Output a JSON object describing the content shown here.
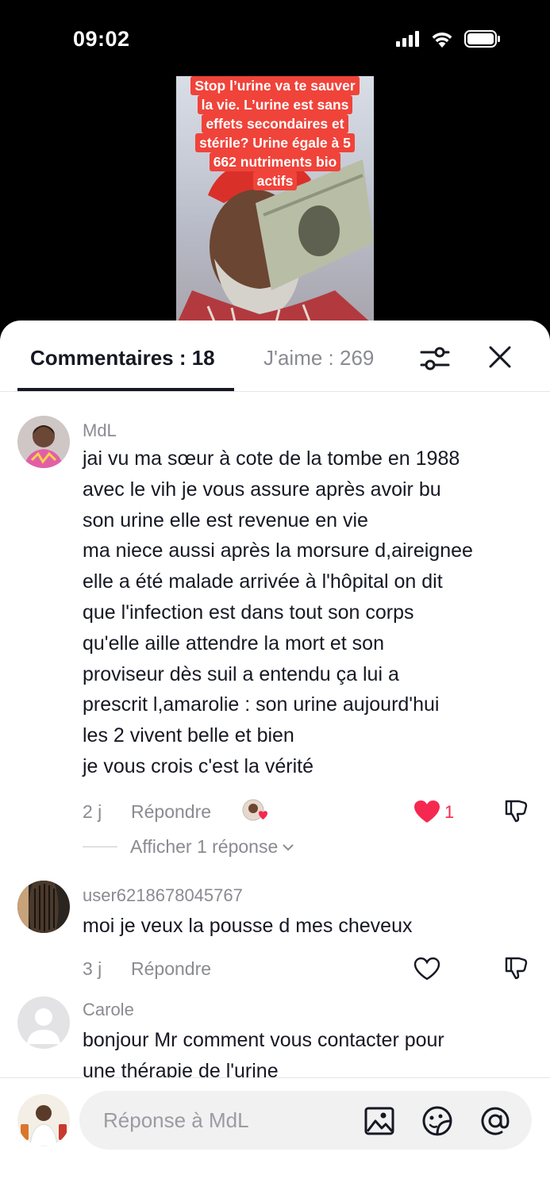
{
  "status_bar": {
    "time": "09:02"
  },
  "video": {
    "caption_lines": [
      "Stop l’urine va te sauver",
      "la vie. L’urine est sans",
      "effets secondaires et",
      "stérile? Urine égale à 5",
      "662 nutriments bio",
      "actifs"
    ]
  },
  "tabs": {
    "comments": "Commentaires : 18",
    "likes": "J'aime : 269"
  },
  "comments": [
    {
      "user": "MdL",
      "text": "jai vu ma sœur à cote de la tombe en 1988\navec le vih je vous assure après avoir bu\nson urine elle est revenue en vie\nma niece aussi après la morsure d,aireignee\nelle a été malade arrivée à l'hôpital on dit\nque l'infection est dans tout son corps\nqu'elle aille attendre la mort et son\nproviseur dès suil a entendu ça lui a\nprescrit l,amarolie : son urine aujourd'hui\nles 2 vivent belle et bien\nje vous crois c'est la vérité",
      "time": "2 j",
      "reply": "Répondre",
      "likes": "1",
      "liked": true,
      "show_replies": "Afficher 1 réponse"
    },
    {
      "user": "user6218678045767",
      "text": "moi je veux la pousse d mes cheveux",
      "time": "3 j",
      "reply": "Répondre"
    },
    {
      "user": "Carole",
      "text": "bonjour Mr comment vous contacter pour\nune thérapie de l'urine"
    }
  ],
  "input": {
    "placeholder": "Réponse à MdL"
  },
  "colors": {
    "accent_red": "#f5294f",
    "caption_bg": "#f0433a",
    "text_primary": "#161823",
    "text_secondary": "#8a8b91"
  }
}
